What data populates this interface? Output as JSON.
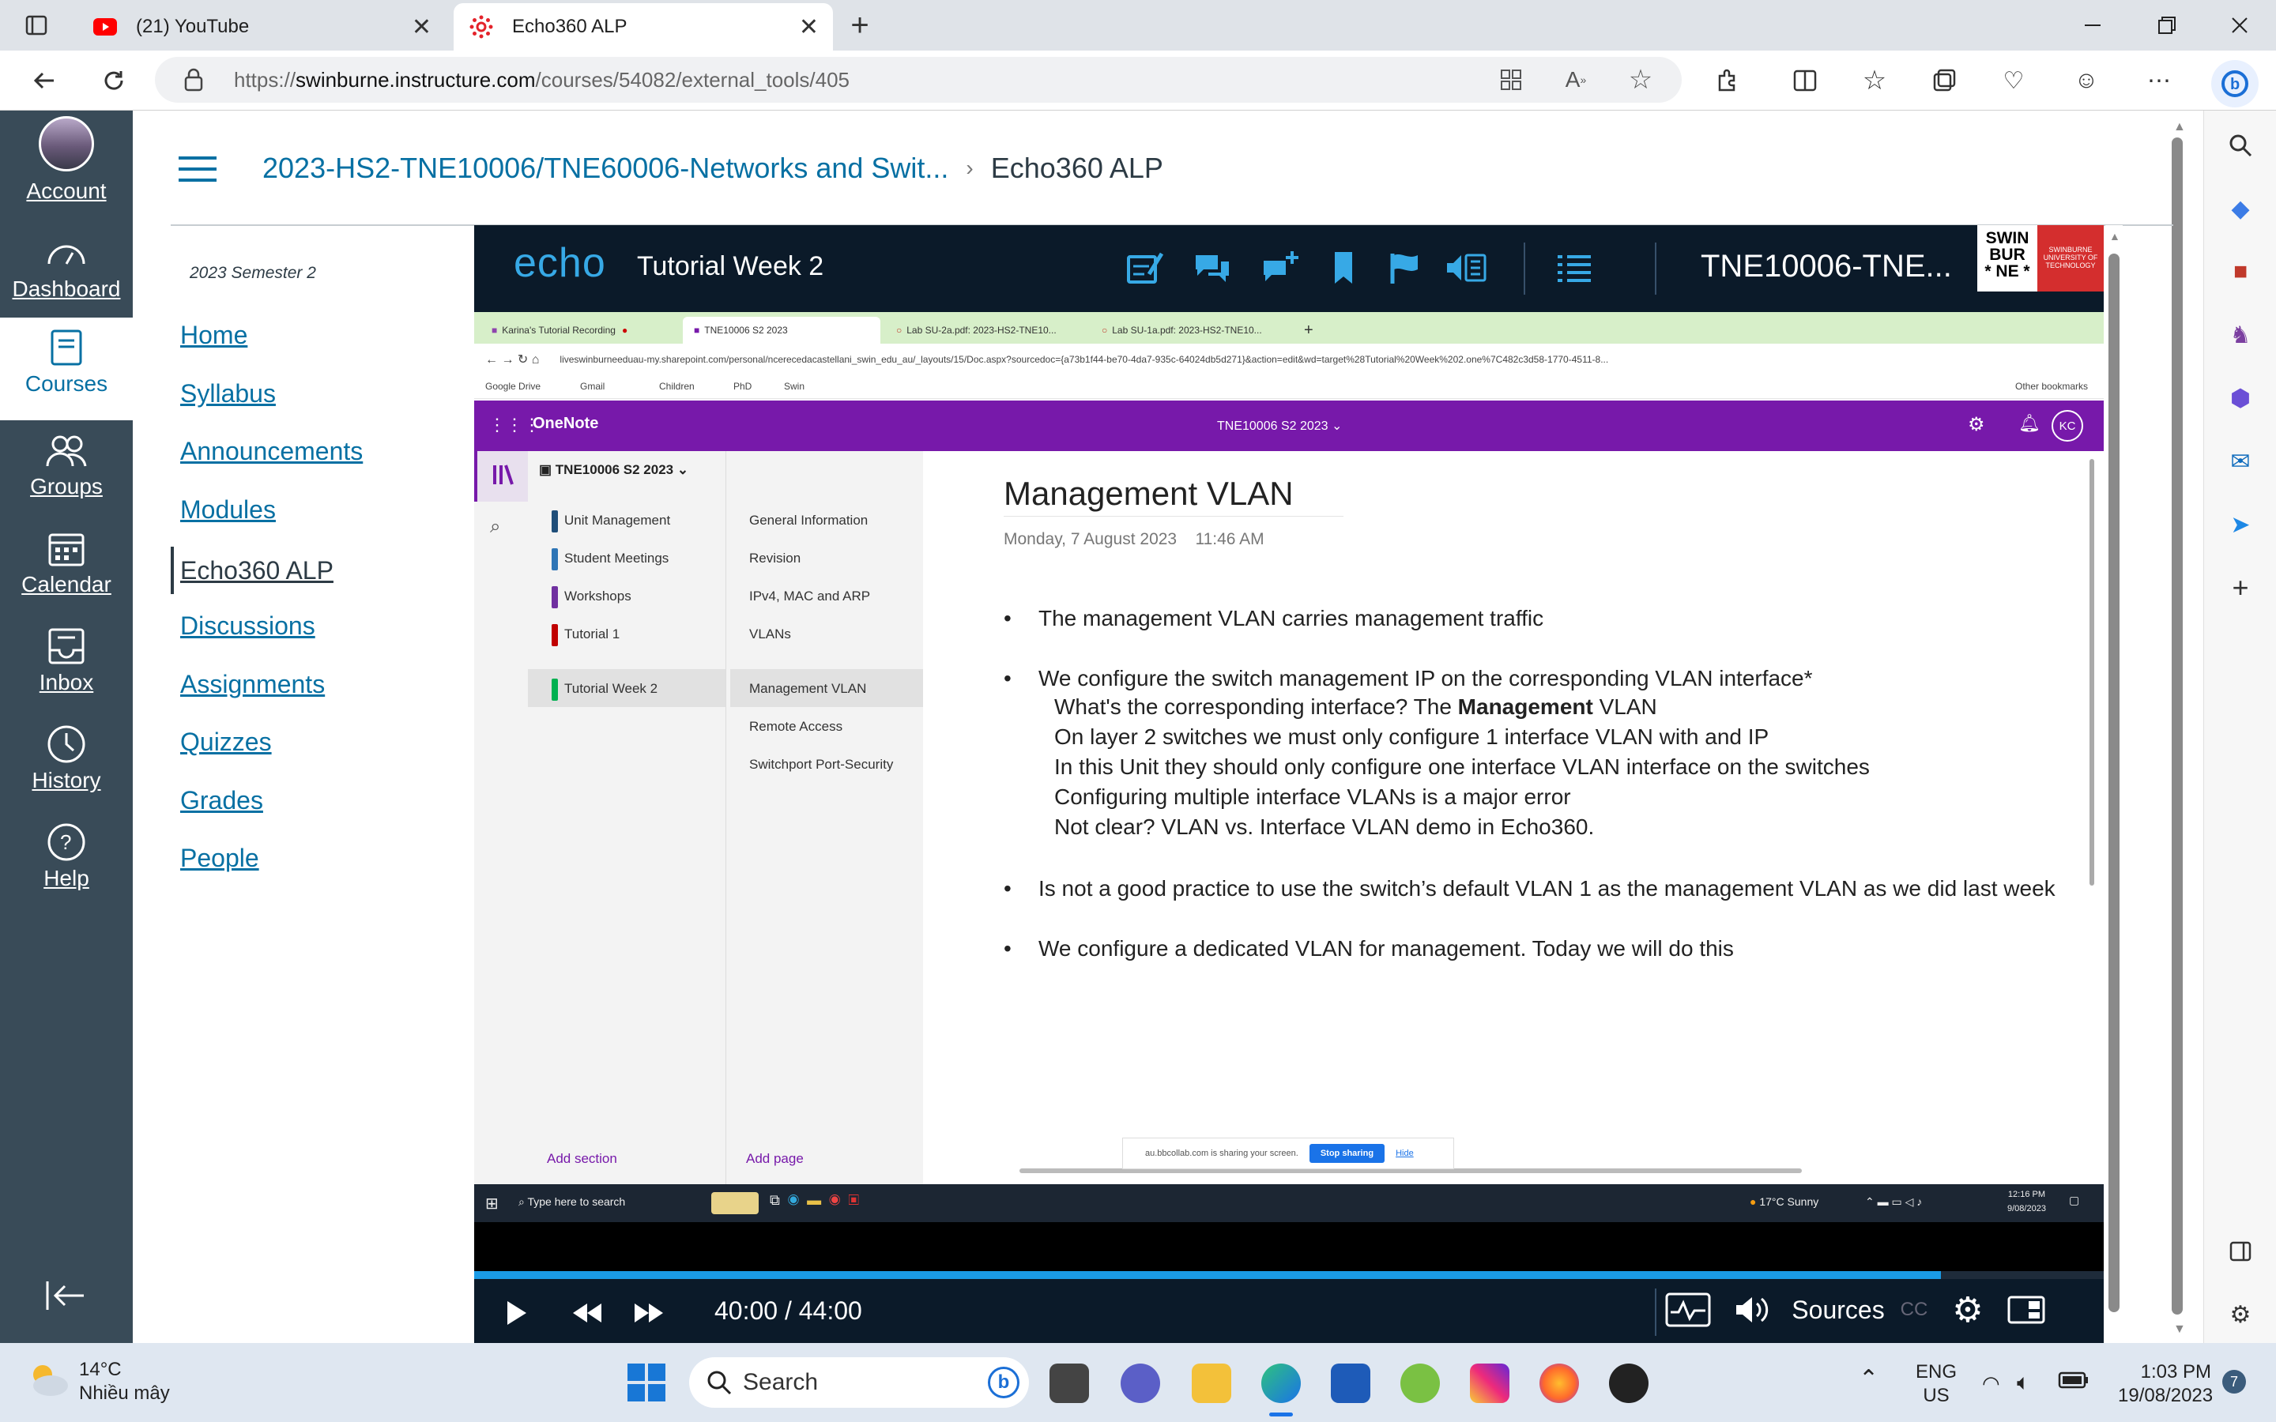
{
  "browser": {
    "tabs": [
      {
        "label": "(21) YouTube",
        "icon": "youtube-icon"
      },
      {
        "label": "Echo360 ALP",
        "icon": "canvas-icon",
        "active": true
      }
    ],
    "url_prefix": "https://",
    "url_domain": "swinburne.instructure.com",
    "url_path": "/courses/54082/external_tools/405"
  },
  "global_nav": {
    "items": [
      {
        "label": "Account",
        "icon": "avatar-icon"
      },
      {
        "label": "Dashboard",
        "icon": "dashboard-icon"
      },
      {
        "label": "Courses",
        "icon": "book-icon",
        "active": true
      },
      {
        "label": "Groups",
        "icon": "groups-icon"
      },
      {
        "label": "Calendar",
        "icon": "calendar-icon"
      },
      {
        "label": "Inbox",
        "icon": "inbox-icon"
      },
      {
        "label": "History",
        "icon": "clock-icon"
      },
      {
        "label": "Help",
        "icon": "help-icon"
      }
    ]
  },
  "breadcrumb": {
    "course": "2023-HS2-TNE10006/TNE60006-Networks and Swit...",
    "separator": "›",
    "current": "Echo360 ALP"
  },
  "course_nav": {
    "term": "2023 Semester 2",
    "items": [
      "Home",
      "Syllabus",
      "Announcements",
      "Modules",
      "Echo360 ALP",
      "Discussions",
      "Assignments",
      "Quizzes",
      "Grades",
      "People"
    ],
    "active": "Echo360 ALP"
  },
  "player": {
    "logo": "echo",
    "title": "Tutorial Week 2",
    "course": "TNE10006-TNE...",
    "brand_lines": [
      "SWIN",
      "BUR",
      "* NE *"
    ],
    "brand_sub": "SWINBURNE UNIVERSITY OF TECHNOLOGY",
    "time": "40:00 / 44:00",
    "progress": 0.9,
    "sources_label": "Sources",
    "cc_label": "CC"
  },
  "video": {
    "tabs": [
      "Karina's Tutorial Recording",
      "TNE10006 S2 2023",
      "Lab SU-2a.pdf: 2023-HS2-TNE10...",
      "Lab SU-1a.pdf: 2023-HS2-TNE10..."
    ],
    "url": "liveswinburneeduau-my.sharepoint.com/personal/ncerecedacastellani_swin_edu_au/_layouts/15/Doc.aspx?sourcedoc={a73b1f44-be70-4da7-935c-64024db5d271}&action=edit&wd=target%28Tutorial%20Week%202.one%7C482c3d58-1770-4511-8...",
    "bookmarks": [
      "Google Drive",
      "Gmail",
      "Children",
      "PhD",
      "Swin"
    ],
    "other_bookmarks": "Other bookmarks",
    "app_name": "OneNote",
    "notebook_header": "TNE10006 S2 2023 ⌄",
    "user_initials": "KC",
    "notebook": "TNE10006 S2 2023",
    "sections": [
      {
        "label": "Unit Management",
        "color": "#1f4e79"
      },
      {
        "label": "Student Meetings",
        "color": "#2e75b6"
      },
      {
        "label": "Workshops",
        "color": "#7030a0"
      },
      {
        "label": "Tutorial 1",
        "color": "#c00000"
      },
      {
        "label": "Tutorial Week 2",
        "color": "#00b050",
        "active": true
      }
    ],
    "pages": [
      "General Information",
      "Revision",
      "IPv4, MAC and ARP",
      "VLANs",
      "Management VLAN",
      "Remote Access",
      "Switchport Port-Security"
    ],
    "active_page": "Management VLAN",
    "add_section": "Add section",
    "add_page": "Add page",
    "page_title": "Management VLAN",
    "page_date": "Monday, 7 August 2023",
    "page_time": "11:46 AM",
    "bullets": [
      "The management VLAN carries management traffic",
      "We configure the switch management IP on the corresponding VLAN interface*",
      "Is not a good practice to use the switch’s default VLAN 1 as the management VLAN as we did last week",
      "We configure a dedicated VLAN for management. Today we will do this"
    ],
    "sub_q_prefix": "What's the corresponding interface? The ",
    "sub_q_bold": "Management",
    "sub_q_suffix": " VLAN",
    "sub_lines": [
      "On layer 2 switches we must only configure 1 interface VLAN with and IP",
      "In this Unit they should only configure one interface VLAN interface on the switches",
      "Configuring multiple interface VLANs is a major error",
      "Not clear? VLAN vs. Interface VLAN demo in Echo360."
    ],
    "share_text": "au.bbcollab.com is sharing your screen.",
    "stop_sharing": "Stop sharing",
    "hide": "Hide",
    "win_search": "Type here to search",
    "win_weather": "17°C  Sunny",
    "win_time": "12:16 PM",
    "win_date": "9/08/2023"
  },
  "taskbar": {
    "temp": "14°C",
    "weather": "Nhiều mây",
    "search": "Search",
    "lang1": "ENG",
    "lang2": "US",
    "time": "1:03 PM",
    "date": "19/08/2023",
    "notifications": "7"
  }
}
